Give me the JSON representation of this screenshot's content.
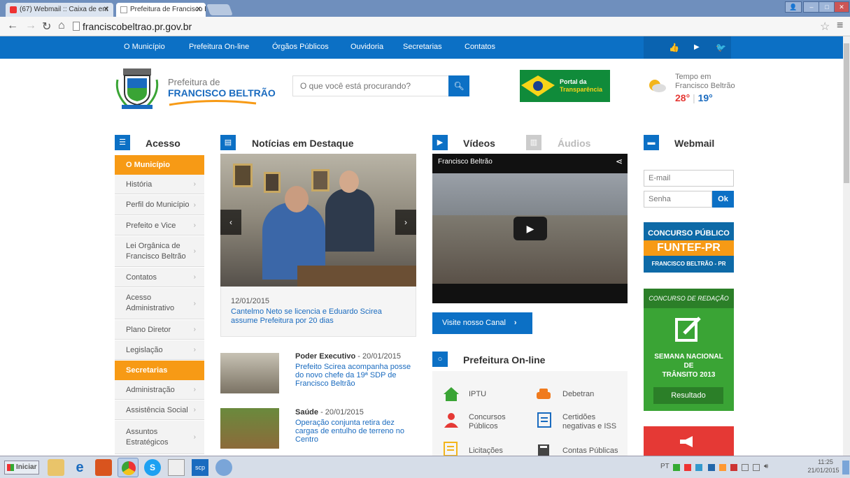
{
  "browser": {
    "tabs": [
      {
        "label": "(67) Webmail :: Caixa de ent"
      },
      {
        "label": "Prefeitura de Francisco Beltr"
      }
    ],
    "url": "franciscobeltrao.pr.gov.br"
  },
  "nav": {
    "items": [
      "O Município",
      "Prefeitura On-line",
      "Órgãos Públicos",
      "Ouvidoria",
      "Secretarias",
      "Contatos"
    ]
  },
  "header": {
    "logo_line1": "Prefeitura de",
    "logo_line2": "FRANCISCO BELTRÃO",
    "search_placeholder": "O que você está procurando?",
    "portal_line1": "Portal da",
    "portal_line2": "Transparência",
    "weather_line1": "Tempo em",
    "weather_line2": "Francisco Beltrão",
    "temp_max": "28°",
    "temp_sep": "|",
    "temp_min": "19°"
  },
  "sidebar": {
    "title": "Acesso",
    "section1": "O Município",
    "items1": [
      "História",
      "Perfil do Município",
      "Prefeito e Vice",
      "Lei Orgânica de Francisco Beltrão",
      "Contatos",
      "Acesso Administrativo",
      "Plano Diretor",
      "Legislação"
    ],
    "section2": "Secretarias",
    "items2": [
      "Administração",
      "Assistência Social",
      "Assuntos Estratégicos"
    ]
  },
  "news": {
    "title": "Notícias em Destaque",
    "featured_date": "12/01/2015",
    "featured_headline": "Cantelmo Neto se licencia e Eduardo Scirea assume Prefeitura por 20 dias",
    "items": [
      {
        "category": "Poder Executivo",
        "date": " - 20/01/2015",
        "headline": "Prefeito Scirea acompanha posse do novo chefe da 19ª SDP de Francisco Beltrão"
      },
      {
        "category": "Saúde",
        "date": " - 20/01/2015",
        "headline": "Operação conjunta retira dez cargas de entulho de terreno no Centro"
      }
    ]
  },
  "media": {
    "videos_tab": "Vídeos",
    "audios_tab": "Áudios",
    "video_title": "Francisco Beltrão",
    "channel_button": "Visite nosso Canal"
  },
  "online": {
    "title": "Prefeitura On-line",
    "services": [
      "IPTU",
      "Debetran",
      "Concursos Públicos",
      "Certidões negativas e ISS",
      "Licitações",
      "Contas Públicas"
    ]
  },
  "webmail": {
    "title": "Webmail",
    "email_placeholder": "E-mail",
    "password_placeholder": "Senha",
    "ok": "Ok"
  },
  "banners": {
    "concurso_line1": "CONCURSO PÚBLICO",
    "concurso_line2": "FUNTEF-PR",
    "concurso_line3": "FRANCISCO BELTRÃO - PR",
    "redacao_line1": "CONCURSO DE REDAÇÃO",
    "redacao_line2": "SEMANA NACIONAL",
    "redacao_line3": "DE",
    "redacao_line4": "TRÂNSITO 2013",
    "redacao_button": "Resultado"
  },
  "taskbar": {
    "start": "Iniciar",
    "lang": "PT",
    "time": "11:25",
    "date": "21/01/2015"
  },
  "colors": {
    "primary": "#0c70c5",
    "orange": "#f79a15",
    "green": "#3aa435",
    "red": "#e53935"
  }
}
